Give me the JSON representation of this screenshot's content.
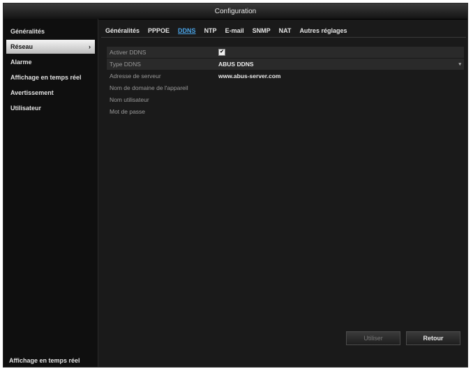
{
  "window": {
    "title": "Configuration"
  },
  "sidebar": {
    "items": [
      {
        "label": "Généralités"
      },
      {
        "label": "Réseau"
      },
      {
        "label": "Alarme"
      },
      {
        "label": "Affichage en temps réel"
      },
      {
        "label": "Avertissement"
      },
      {
        "label": "Utilisateur"
      }
    ],
    "active_arrow": "›",
    "footer": "Affichage en temps réel"
  },
  "tabs": [
    "Généralités",
    "PPPOE",
    "DDNS",
    "NTP",
    "E-mail",
    "SNMP",
    "NAT",
    "Autres réglages"
  ],
  "active_tab": "DDNS",
  "form": {
    "enable_label": "Activer DDNS",
    "enable_checked": "✔",
    "type_label": "Type DDNS",
    "type_value": "ABUS DDNS",
    "server_label": "Adresse de serveur",
    "server_value": "www.abus-server.com",
    "domain_label": "Nom de domaine de l'appareil",
    "user_label": "Nom utilisateur",
    "password_label": "Mot de passe"
  },
  "buttons": {
    "apply": "Utiliser",
    "back": "Retour"
  },
  "colors": {
    "accent": "#4aa3e6",
    "background": "#1a1a1a"
  }
}
